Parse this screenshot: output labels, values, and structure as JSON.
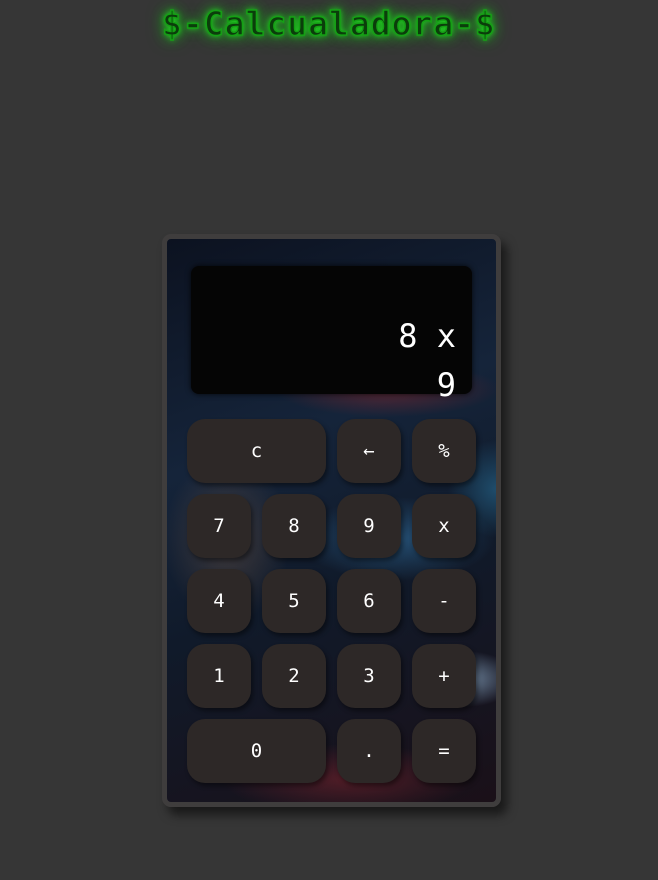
{
  "header": {
    "title": "$-Calcualadora-$"
  },
  "display": {
    "expression": "8 x",
    "current": "9"
  },
  "buttons": {
    "clear": "c",
    "backspace": "←",
    "percent": "%",
    "seven": "7",
    "eight": "8",
    "nine": "9",
    "multiply": "x",
    "four": "4",
    "five": "5",
    "six": "6",
    "subtract": "-",
    "one": "1",
    "two": "2",
    "three": "3",
    "add": "+",
    "zero": "0",
    "decimal": ".",
    "equals": "="
  },
  "colors": {
    "page_background": "#363636",
    "title_glow": "#20e020",
    "button_background": "#2d2827",
    "display_background": "#050505"
  }
}
